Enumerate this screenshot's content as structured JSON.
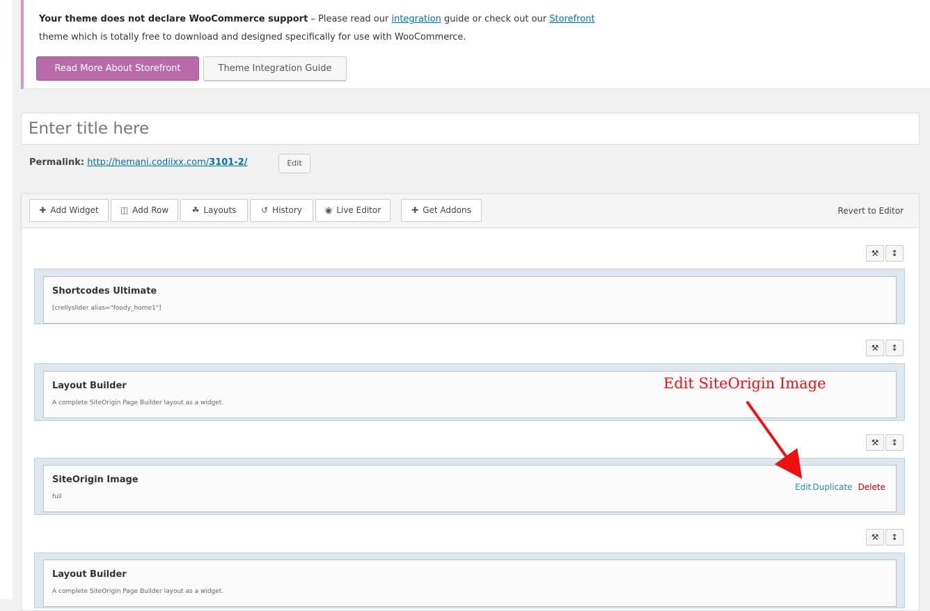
{
  "notice": {
    "bold": "Your theme does not declare WooCommerce support",
    "text_a": " – Please read our ",
    "link_integration": "integration",
    "text_b": " guide or check out our ",
    "link_storefront": "Storefront",
    "line2": "theme which is totally free to download and designed specifically for use with WooCommerce.",
    "btn_primary": "Read More About Storefront",
    "btn_secondary": "Theme Integration Guide"
  },
  "editor": {
    "title_placeholder": "Enter title here",
    "permalink_label": "Permalink:",
    "permalink_base": "http://hemani.codiixx.com/",
    "permalink_slug": "3101-2/",
    "permalink_edit": "Edit"
  },
  "toolbar": {
    "add_widget": "Add Widget",
    "add_row": "Add Row",
    "layouts": "Layouts",
    "history": "History",
    "live_editor": "Live Editor",
    "get_addons": "Get Addons",
    "revert": "Revert to Editor"
  },
  "widgets": [
    {
      "title": "Shortcodes Ultimate",
      "desc": "[crellyslider alias=\"foody_home1\"]"
    },
    {
      "title": "Layout Builder",
      "desc": "A complete SiteOrigin Page Builder layout as a widget."
    },
    {
      "title": "SiteOrigin Image",
      "desc": "full"
    },
    {
      "title": "Layout Builder",
      "desc": "A complete SiteOrigin Page Builder layout as a widget."
    }
  ],
  "widget_actions": {
    "edit": "Edit",
    "duplicate": "Duplicate",
    "delete": "Delete"
  },
  "annotation": "Edit SiteOrigin Image",
  "icons": {
    "plus": "plus-icon",
    "columns": "columns-icon",
    "layouts": "layouts-icon",
    "history": "undo-icon",
    "eye": "eye-icon",
    "wrench": "wrench-icon",
    "move": "move-icon"
  },
  "colors": {
    "accent": "#b96aa8",
    "link": "#0073aa",
    "annotation": "#ee1111"
  }
}
